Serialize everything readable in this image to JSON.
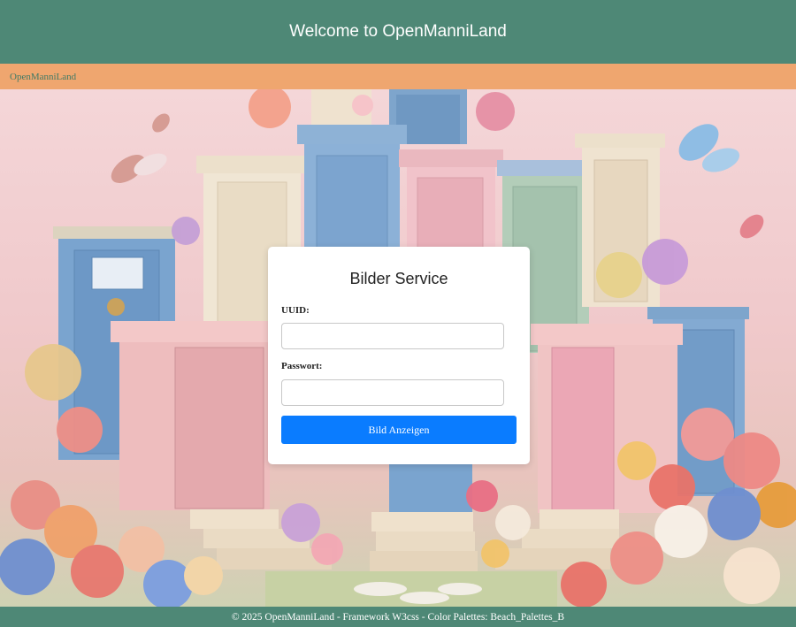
{
  "header": {
    "title": "Welcome to OpenManniLand"
  },
  "nav": {
    "brand": "OpenManniLand"
  },
  "login": {
    "title": "Bilder Service",
    "uuid_label": "UUID:",
    "uuid_value": "",
    "password_label": "Passwort:",
    "password_value": "",
    "submit_label": "Bild Anzeigen"
  },
  "footer": {
    "text": "© 2025 OpenManniLand - Framework W3css - Color Palettes: Beach_Palettes_B"
  },
  "colors": {
    "header_bg": "#4e8876",
    "nav_bg": "#efa66f",
    "nav_text": "#3f7a66",
    "button_bg": "#0a7cff",
    "footer_bg": "#4e8876"
  },
  "background_image": {
    "subject": "pastel doors with flowers and butterflies"
  }
}
